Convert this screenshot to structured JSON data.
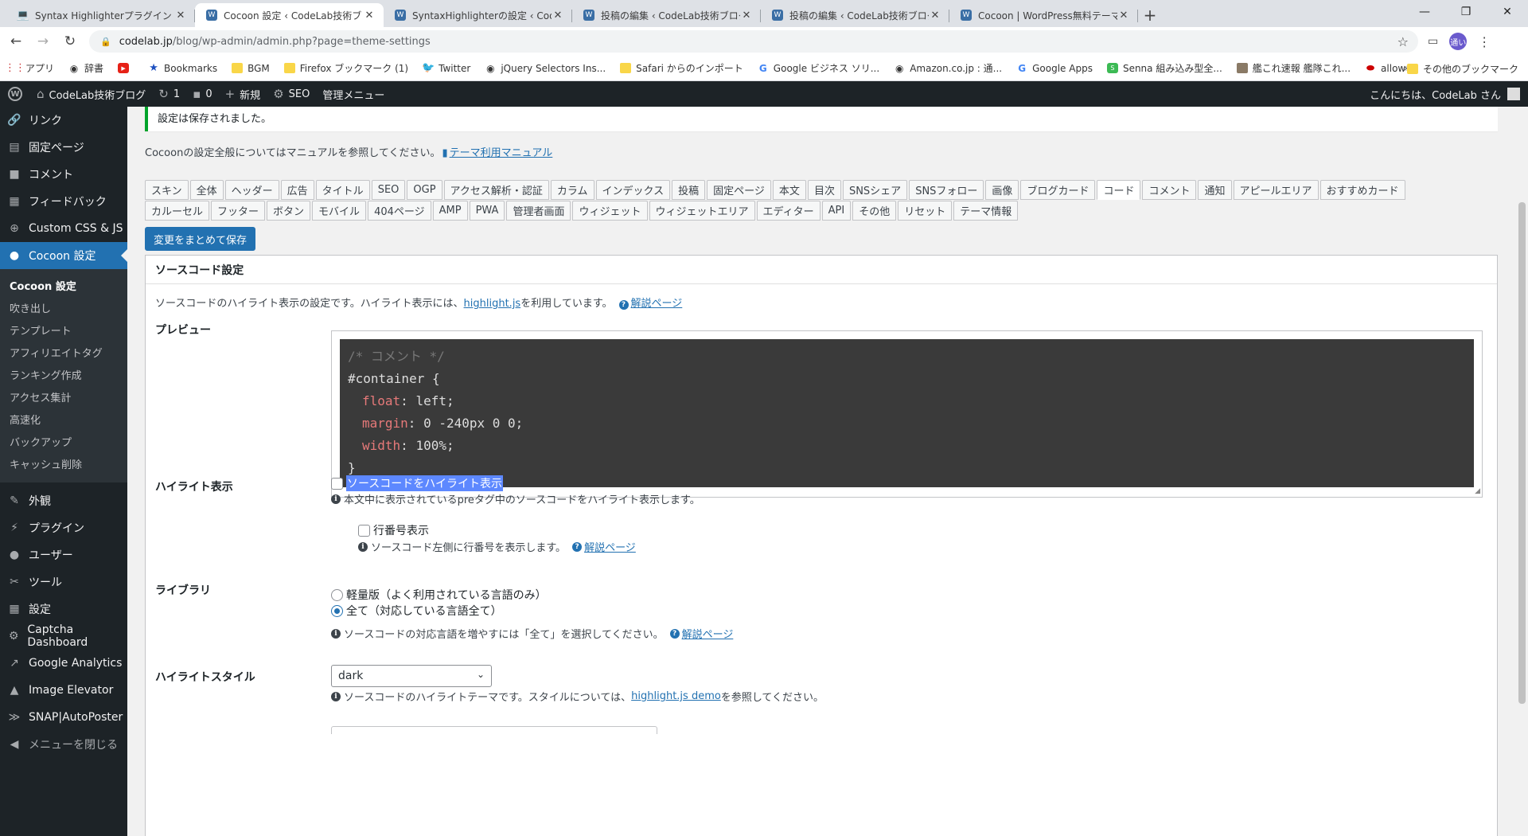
{
  "browser": {
    "tabs": [
      {
        "title": "Syntax Highlighterプラグイン Crayo",
        "icon": "laptop-icon"
      },
      {
        "title": "Cocoon 設定 ‹ CodeLab技術ブログ",
        "icon": "wordpress-icon",
        "active": true
      },
      {
        "title": "SyntaxHighlighterの設定 ‹ CodeLa",
        "icon": "wordpress-icon"
      },
      {
        "title": "投稿の編集 ‹ CodeLab技術ブログ —",
        "icon": "wordpress-icon"
      },
      {
        "title": "投稿の編集 ‹ CodeLab技術ブログ —",
        "icon": "wordpress-icon"
      },
      {
        "title": "Cocoon | WordPress無料テーマ",
        "icon": "wordpress-icon"
      }
    ],
    "url_host": "codelab.jp",
    "url_path": "/blog/wp-admin/admin.php?page=theme-settings",
    "profile": "通い",
    "bookmarks": [
      {
        "label": "アプリ",
        "icon": "apps"
      },
      {
        "label": "辞書",
        "icon": "gray"
      },
      {
        "label": "",
        "icon": "red"
      },
      {
        "label": "Bookmarks",
        "icon": "blue"
      },
      {
        "label": "BGM",
        "icon": "folder"
      },
      {
        "label": "Firefox ブックマーク (1)",
        "icon": "folder"
      },
      {
        "label": "Twitter",
        "icon": "tw"
      },
      {
        "label": "jQuery Selectors Ins...",
        "icon": "gray"
      },
      {
        "label": "Safari からのインポート",
        "icon": "folder"
      },
      {
        "label": "Google ビジネス ソリ...",
        "icon": "g"
      },
      {
        "label": "Amazon.co.jp : 通...",
        "icon": "gray"
      },
      {
        "label": "Google Apps",
        "icon": "g"
      },
      {
        "label": "Senna 組み込み型全...",
        "icon": "green"
      },
      {
        "label": "艦これ速報 艦隊これ...",
        "icon": "img"
      },
      {
        "label": "allow",
        "icon": "redlogo"
      }
    ],
    "other_bookmarks": "その他のブックマーク"
  },
  "adminbar": {
    "site": "CodeLab技術ブログ",
    "updates": "1",
    "comments": "0",
    "new": "新規",
    "seo": "SEO",
    "admin_menu": "管理メニュー",
    "greeting": "こんにちは、CodeLab さん"
  },
  "sidebar": {
    "items_top": [
      {
        "label": "リンク",
        "icon": "link-icon",
        "glyph": "🔗"
      },
      {
        "label": "固定ページ",
        "icon": "page-icon",
        "glyph": "▤"
      },
      {
        "label": "コメント",
        "icon": "comment-icon",
        "glyph": "■"
      },
      {
        "label": "フィードバック",
        "icon": "feedback-icon",
        "glyph": "▦"
      },
      {
        "label": "Custom CSS & JS",
        "icon": "plus-circle-icon",
        "glyph": "⊕"
      }
    ],
    "current": "Cocoon 設定",
    "submenu": [
      "Cocoon 設定",
      "吹き出し",
      "テンプレート",
      "アフィリエイトタグ",
      "ランキング作成",
      "アクセス集計",
      "高速化",
      "バックアップ",
      "キャッシュ削除"
    ],
    "items_bottom": [
      {
        "label": "外観",
        "icon": "brush-icon",
        "glyph": "✎"
      },
      {
        "label": "プラグイン",
        "icon": "plugin-icon",
        "glyph": "⚡"
      },
      {
        "label": "ユーザー",
        "icon": "user-icon",
        "glyph": "●"
      },
      {
        "label": "ツール",
        "icon": "wrench-icon",
        "glyph": "✂"
      },
      {
        "label": "設定",
        "icon": "settings-icon",
        "glyph": "▦"
      },
      {
        "label": "Captcha Dashboard",
        "icon": "gear-icon",
        "glyph": "⚙"
      },
      {
        "label": "Google Analytics",
        "icon": "chart-icon",
        "glyph": "↗"
      },
      {
        "label": "Image Elevator",
        "icon": "elevator-icon",
        "glyph": "▲"
      },
      {
        "label": "SNAP|AutoPoster",
        "icon": "snap-icon",
        "glyph": "≫"
      },
      {
        "label": "メニューを閉じる",
        "icon": "collapse-icon",
        "glyph": "◀"
      }
    ]
  },
  "main": {
    "notice": "設定は保存されました。",
    "intro_text": "Cocoonの設定全般についてはマニュアルを参照してください。",
    "intro_link": "テーマ利用マニュアル",
    "tabs_row1": [
      "スキン",
      "全体",
      "ヘッダー",
      "広告",
      "タイトル",
      "SEO",
      "OGP",
      "アクセス解析・認証",
      "カラム",
      "インデックス",
      "投稿",
      "固定ページ",
      "本文",
      "目次",
      "SNSシェア",
      "SNSフォロー",
      "画像",
      "ブログカード",
      "コード",
      "コメント",
      "通知",
      "アピールエリア",
      "おすすめカード"
    ],
    "tabs_row2": [
      "カルーセル",
      "フッター",
      "ボタン",
      "モバイル",
      "404ページ",
      "AMP",
      "PWA",
      "管理者画面",
      "ウィジェット",
      "ウィジェットエリア",
      "エディター",
      "API",
      "その他",
      "リセット",
      "テーマ情報"
    ],
    "active_tab": "コード",
    "save_all": "変更をまとめて保存",
    "panel_title": "ソースコード設定",
    "desc_before": "ソースコードのハイライト表示の設定です。ハイライト表示には、",
    "desc_link": "highlight.js",
    "desc_after": "を利用しています。",
    "help_link": "解説ページ",
    "preview_label": "プレビュー",
    "code_lines": {
      "l1": "/* コメント */",
      "l2": "#container {",
      "l3p": "float",
      "l3v": ": left;",
      "l4p": "margin",
      "l4v": ": 0 -240px 0 0;",
      "l5p": "width",
      "l5v": ": 100%;",
      "l6": "}"
    },
    "highlight_label": "ハイライト表示",
    "highlight_checkbox": "ソースコードをハイライト表示",
    "highlight_hint": "本文中に表示されているpreタグ中のソースコードをハイライト表示します。",
    "linenum_checkbox": "行番号表示",
    "linenum_hint": "ソースコード左側に行番号を表示します。",
    "library_label": "ライブラリ",
    "library_opt1": "軽量版（よく利用されている言語のみ）",
    "library_opt2": "全て（対応している言語全て）",
    "library_hint": "ソースコードの対応言語を増やすには「全て」を選択してください。",
    "style_label": "ハイライトスタイル",
    "style_value": "dark",
    "style_hint_before": "ソースコードのハイライトテーマです。スタイルについては、",
    "style_hint_link": "highlight.js demo",
    "style_hint_after": "を参照してください。"
  }
}
